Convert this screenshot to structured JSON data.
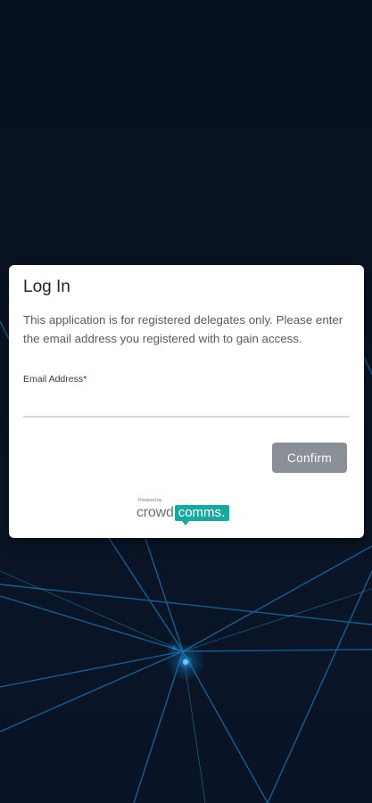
{
  "dialog": {
    "title": "Log In",
    "description": "This application is for registered delegates only. Please enter the email address you registered with to gain access.",
    "email_label": "Email Address*",
    "email_value": "",
    "email_placeholder": "",
    "confirm_label": "Confirm"
  },
  "branding": {
    "powered_by": "Powered by",
    "logo_part1": "crowd",
    "logo_part2": "comms",
    "logo_suffix": "."
  },
  "colors": {
    "background": "#08111f",
    "line_glow": "#1b7fc4",
    "button_disabled": "#8a9095",
    "brand_teal": "#1aa6a1"
  }
}
